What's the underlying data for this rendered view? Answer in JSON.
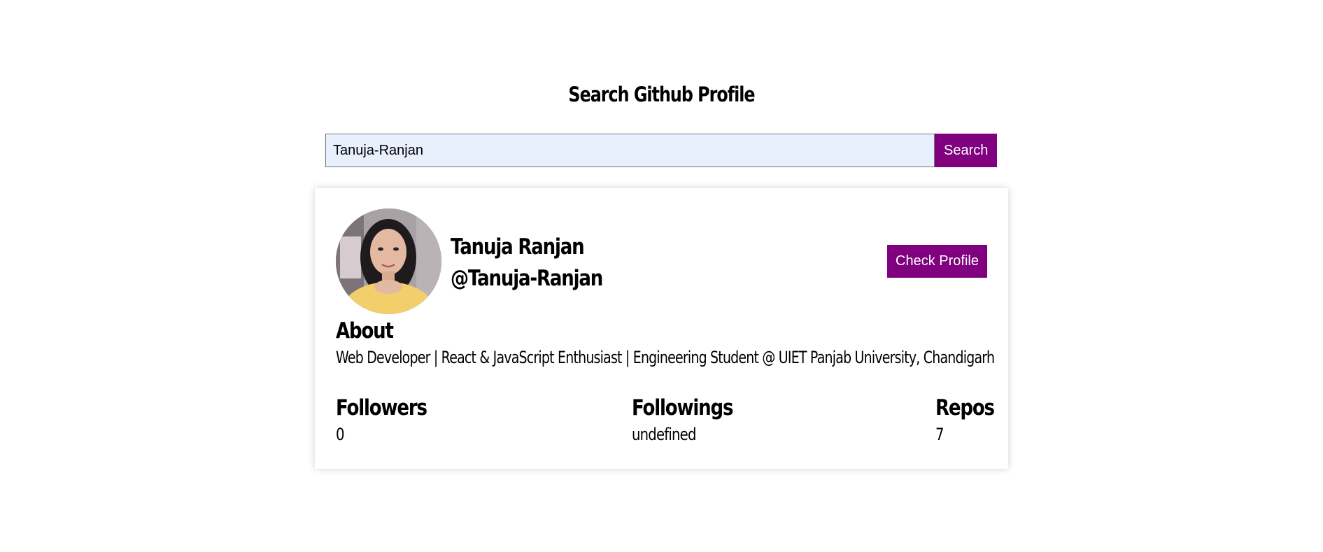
{
  "header": {
    "title": "Search Github Profile"
  },
  "search": {
    "value": "Tanuja-Ranjan",
    "button_label": "Search"
  },
  "profile": {
    "name": "Tanuja Ranjan",
    "handle": "@Tanuja-Ranjan",
    "avatar_icon": "user-avatar-photo",
    "check_button_label": "Check Profile",
    "about_heading": "About",
    "about_text": "Web Developer | React & JavaScript Enthusiast | Engineering Student @ UIET Panjab University, Chandigarh",
    "stats": {
      "followers_label": "Followers",
      "followers_value": "0",
      "followings_label": "Followings",
      "followings_value": "undefined",
      "repos_label": "Repos",
      "repos_value": "7"
    }
  },
  "colors": {
    "accent": "#800080",
    "input_bg": "#e8f0fe"
  }
}
